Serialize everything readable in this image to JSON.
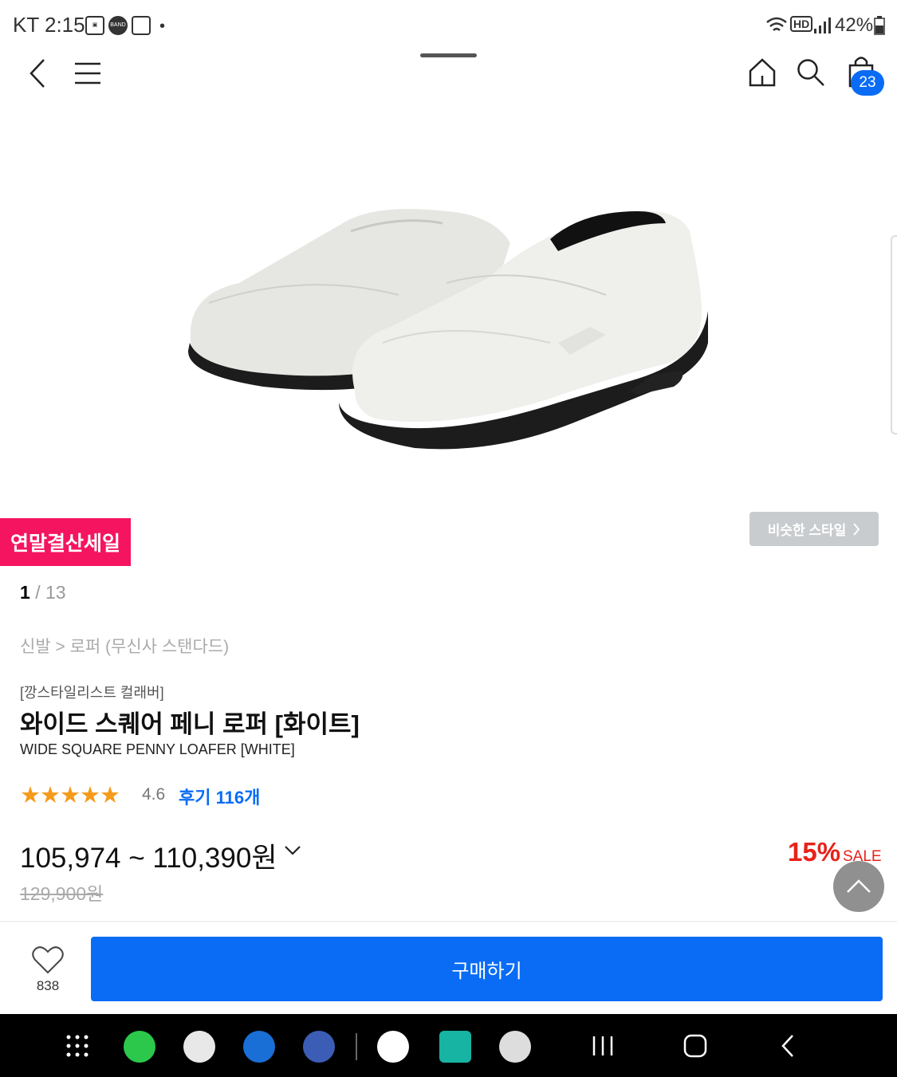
{
  "status": {
    "carrier_time": "KT 2:15",
    "notif_icons": [
      "gallery-icon",
      "band-icon",
      "app-icon"
    ],
    "battery_text": "42%",
    "network_label": "HD"
  },
  "nav": {
    "cart_count": "23"
  },
  "badges": {
    "sale_event": "연말결산세일",
    "similar_style": "비슷한 스타일"
  },
  "gallery": {
    "current": "1",
    "total": "/ 13"
  },
  "breadcrumb": "신발 > 로퍼 (무신사 스탠다드)",
  "product": {
    "brand": "[깡스타일리스트 컬래버]",
    "name": "와이드 스퀘어 페니 로퍼 [화이트]",
    "name_en": "WIDE SQUARE PENNY LOAFER [WHITE]",
    "stars": "★★★★★",
    "rating": "4.6",
    "reviews": "후기 116개",
    "price_range": "105,974 ~ 110,390원",
    "original_price": "129,900원",
    "discount": "15%",
    "sale_label": "SALE"
  },
  "actions": {
    "like_count": "838",
    "buy_label": "구매하기"
  },
  "colors": {
    "accent_blue": "#0a6cf5",
    "sale_pink": "#f5145f",
    "discount_red": "#e8211a",
    "star_orange": "#f59a1a"
  }
}
